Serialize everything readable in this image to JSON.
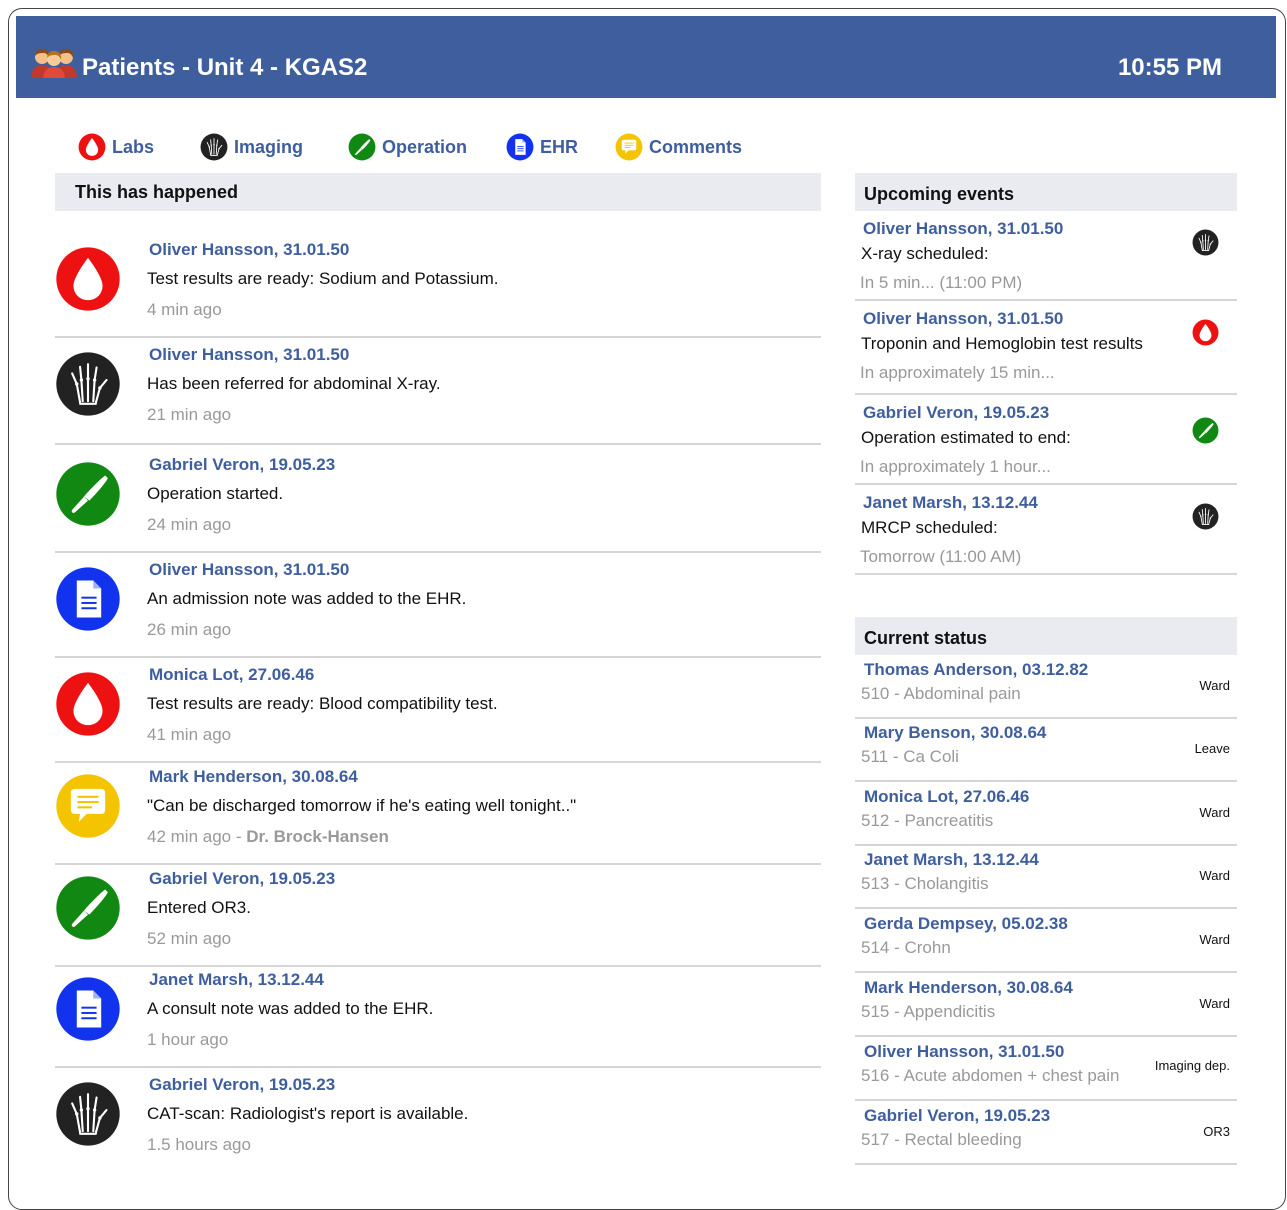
{
  "header": {
    "title": "Patients - Unit 4 - KGAS2",
    "time": "10:55 PM",
    "color": "#3f5e9e"
  },
  "filters": [
    {
      "label": "Labs",
      "icon": "blood-drop-icon",
      "color": "#ee1111"
    },
    {
      "label": "Imaging",
      "icon": "xray-hand-icon",
      "color": "#222222"
    },
    {
      "label": "Operation",
      "icon": "scalpel-icon",
      "color": "#118811"
    },
    {
      "label": "EHR",
      "icon": "document-icon",
      "color": "#1133ee"
    },
    {
      "label": "Comments",
      "icon": "speech-bubble-icon",
      "color": "#f5c400"
    }
  ],
  "feed": {
    "heading": "This has happened",
    "items": [
      {
        "type": "labs",
        "name": "Oliver Hansson, 31.01.50",
        "text": "Test results are ready: Sodium and Potassium.",
        "time": "4 min ago",
        "author": ""
      },
      {
        "type": "imaging",
        "name": "Oliver Hansson, 31.01.50",
        "text": "Has been referred for abdominal X-ray.",
        "time": "21 min ago",
        "author": ""
      },
      {
        "type": "operation",
        "name": "Gabriel Veron, 19.05.23",
        "text": "Operation started.",
        "time": "24 min ago",
        "author": ""
      },
      {
        "type": "ehr",
        "name": "Oliver Hansson, 31.01.50",
        "text": "An admission note was added to the EHR.",
        "time": "26 min ago",
        "author": ""
      },
      {
        "type": "labs",
        "name": "Monica Lot, 27.06.46",
        "text": "Test results are ready: Blood compatibility test.",
        "time": "41 min ago",
        "author": ""
      },
      {
        "type": "comments",
        "name": "Mark Henderson, 30.08.64",
        "text": "\"Can be discharged tomorrow if he's eating well tonight..\"",
        "time": "42 min ago - ",
        "author": "Dr. Brock-Hansen"
      },
      {
        "type": "operation",
        "name": "Gabriel Veron, 19.05.23",
        "text": "Entered OR3.",
        "time": "52 min ago",
        "author": ""
      },
      {
        "type": "ehr",
        "name": "Janet Marsh, 13.12.44",
        "text": "A consult note was added to the EHR.",
        "time": "1 hour ago",
        "author": ""
      },
      {
        "type": "imaging",
        "name": "Gabriel Veron, 19.05.23",
        "text": "CAT-scan: Radiologist's report is available.",
        "time": "1.5 hours ago",
        "author": ""
      }
    ]
  },
  "upcoming": {
    "heading": "Upcoming events",
    "items": [
      {
        "type": "imaging",
        "name": "Oliver Hansson, 31.01.50",
        "text": "X-ray scheduled:",
        "time": "In 5 min... (11:00 PM)"
      },
      {
        "type": "labs",
        "name": "Oliver Hansson, 31.01.50",
        "text": "Troponin and Hemoglobin test results",
        "time": "In approximately 15 min..."
      },
      {
        "type": "operation",
        "name": "Gabriel Veron, 19.05.23",
        "text": "Operation estimated to end:",
        "time": "In approximately 1 hour..."
      },
      {
        "type": "imaging",
        "name": "Janet Marsh, 13.12.44",
        "text": "MRCP scheduled:",
        "time": "Tomorrow (11:00 AM)"
      }
    ]
  },
  "status": {
    "heading": "Current status",
    "items": [
      {
        "name": "Thomas Anderson, 03.12.82",
        "diagnosis": "510 - Abdominal pain",
        "location": "Ward"
      },
      {
        "name": "Mary Benson, 30.08.64",
        "diagnosis": "511 - Ca Coli",
        "location": "Leave"
      },
      {
        "name": "Monica Lot, 27.06.46",
        "diagnosis": "512 - Pancreatitis",
        "location": "Ward"
      },
      {
        "name": "Janet Marsh, 13.12.44",
        "diagnosis": "513 - Cholangitis",
        "location": "Ward"
      },
      {
        "name": "Gerda Dempsey, 05.02.38",
        "diagnosis": "514 - Crohn",
        "location": "Ward"
      },
      {
        "name": "Mark Henderson, 30.08.64",
        "diagnosis": "515 - Appendicitis",
        "location": "Ward"
      },
      {
        "name": "Oliver Hansson, 31.01.50",
        "diagnosis": "516 - Acute abdomen + chest pain",
        "location": "Imaging dep."
      },
      {
        "name": "Gabriel Veron, 19.05.23",
        "diagnosis": "517 - Rectal bleeding",
        "location": "OR3"
      }
    ]
  }
}
